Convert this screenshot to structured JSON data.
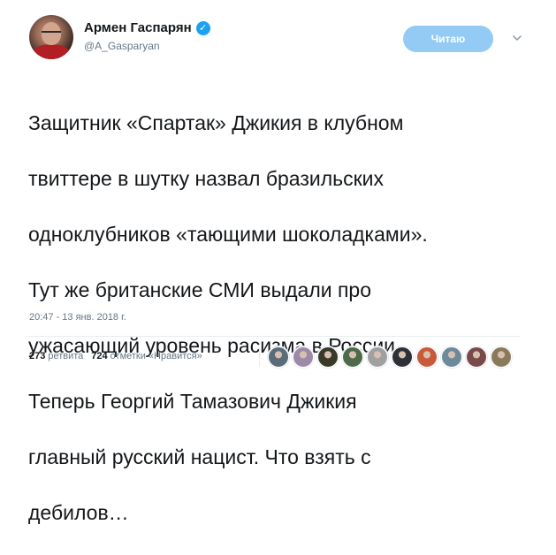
{
  "author": {
    "name": "Армен Гаспарян",
    "handle": "@A_Gasparyan",
    "verified_icon": "✓"
  },
  "follow_button": {
    "label": "Читаю"
  },
  "tweet": {
    "lines": [
      "Защитник «Спартак» Джикия в клубном",
      "твиттере в шутку назвал бразильских",
      "одноклубников «тающими шоколадками».",
      "Тут же британские СМИ выдали про",
      "ужасающий уровень расизма в России.",
      "Теперь Георгий Тамазович Джикия",
      "главный русский нацист. Что взять с",
      "дебилов…"
    ],
    "timestamp": "20:47 - 13 янв. 2018 г."
  },
  "stats": {
    "retweets_count": "273",
    "retweets_label": "ретвита",
    "likes_count": "724",
    "likes_label": "отметки «Нравится»"
  },
  "likers": [
    {
      "color": "#5a6b7a"
    },
    {
      "color": "#9c8aa8"
    },
    {
      "color": "#3a3a2a"
    },
    {
      "color": "#4f6a4a"
    },
    {
      "color": "#a0a0a0"
    },
    {
      "color": "#2f2f38"
    },
    {
      "color": "#c85a3a"
    },
    {
      "color": "#6e8a9a"
    },
    {
      "color": "#7a4a4a"
    },
    {
      "color": "#8a7a5a"
    }
  ]
}
